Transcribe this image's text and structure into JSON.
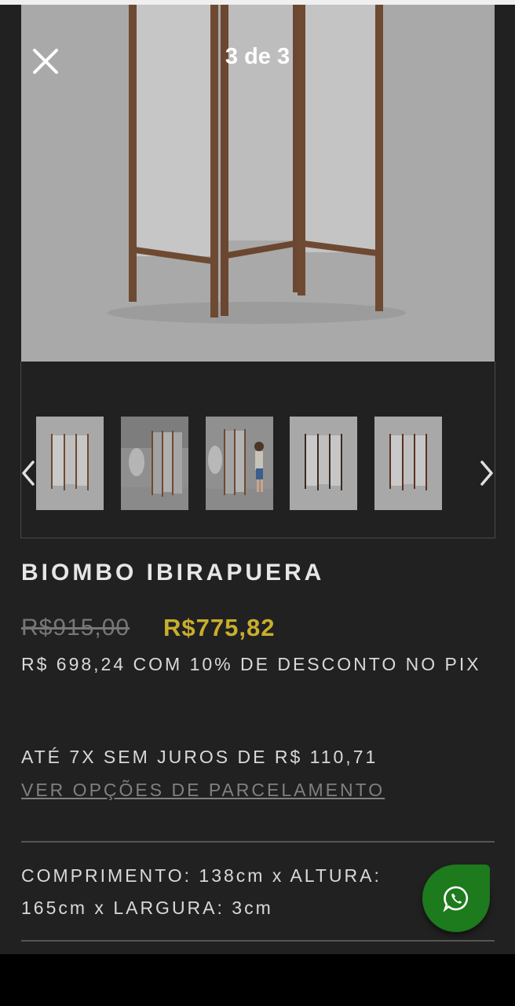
{
  "gallery": {
    "counter": "3 de 3",
    "close_icon": "close-icon",
    "prev_icon": "chevron-left-icon",
    "next_icon": "chevron-right-icon",
    "thumbnails": [
      "thumb-1",
      "thumb-2",
      "thumb-3",
      "thumb-4",
      "thumb-5"
    ]
  },
  "product": {
    "title": "BIOMBO IBIRAPUERA",
    "old_price": "R$915,00",
    "new_price": "R$775,82",
    "pix_text": "R$ 698,24 COM 10% DE DESCONTO NO PIX",
    "installments": "ATÉ 7X SEM JUROS DE R$ 110,71",
    "installment_link": "VER OPÇÕES DE PARCELAMENTO",
    "dimensions": "COMPRIMENTO: 138cm x ALTURA: 165cm x LARGURA: 3cm"
  },
  "colors": {
    "background": "#212121",
    "price_accent": "#c8ae2e",
    "whatsapp": "#1d7a1d"
  },
  "whatsapp_icon": "whatsapp-icon"
}
